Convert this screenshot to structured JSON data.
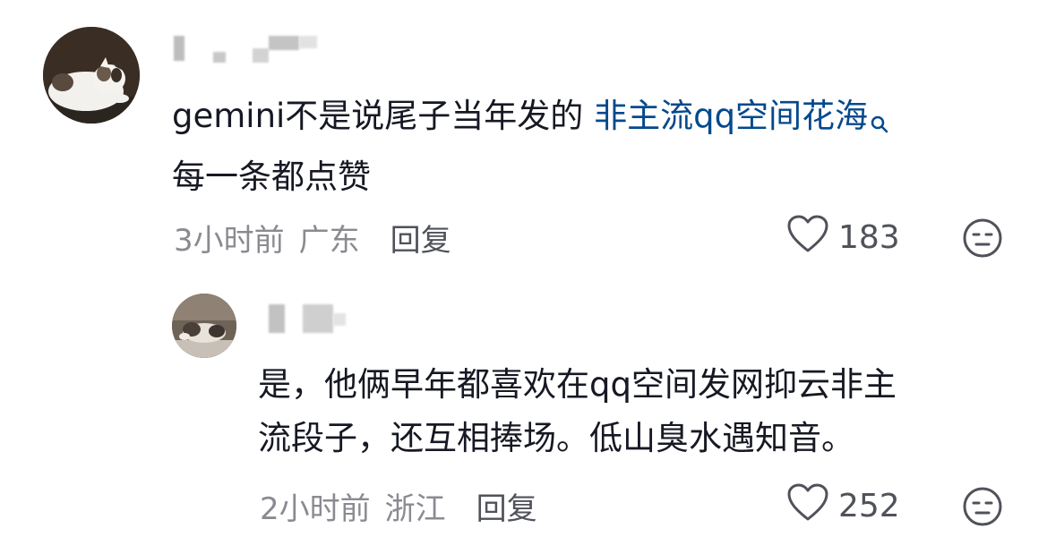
{
  "comment": {
    "text_part1": "gemini不是说尾子当年发的 ",
    "keyword": "非主流qq空间花海",
    "text_line2": "每一条都点赞",
    "time": "3小时前",
    "location": "广东",
    "reply_label": "回复",
    "like_count": "183"
  },
  "reply": {
    "text_line1": "是，他俩早年都喜欢在qq空间发网抑云非主",
    "text_line2": "流段子，还互相捧场。低山臭水遇知音。",
    "time": "2小时前",
    "location": "浙江",
    "reply_label": "回复",
    "like_count": "252"
  },
  "colors": {
    "text": "#161823",
    "meta": "#8a8b91",
    "keyword_link": "#04498d",
    "icon": "#50525a"
  },
  "icons": {
    "search": "search-icon",
    "like": "heart-icon",
    "dislike": "neutral-face-icon"
  }
}
